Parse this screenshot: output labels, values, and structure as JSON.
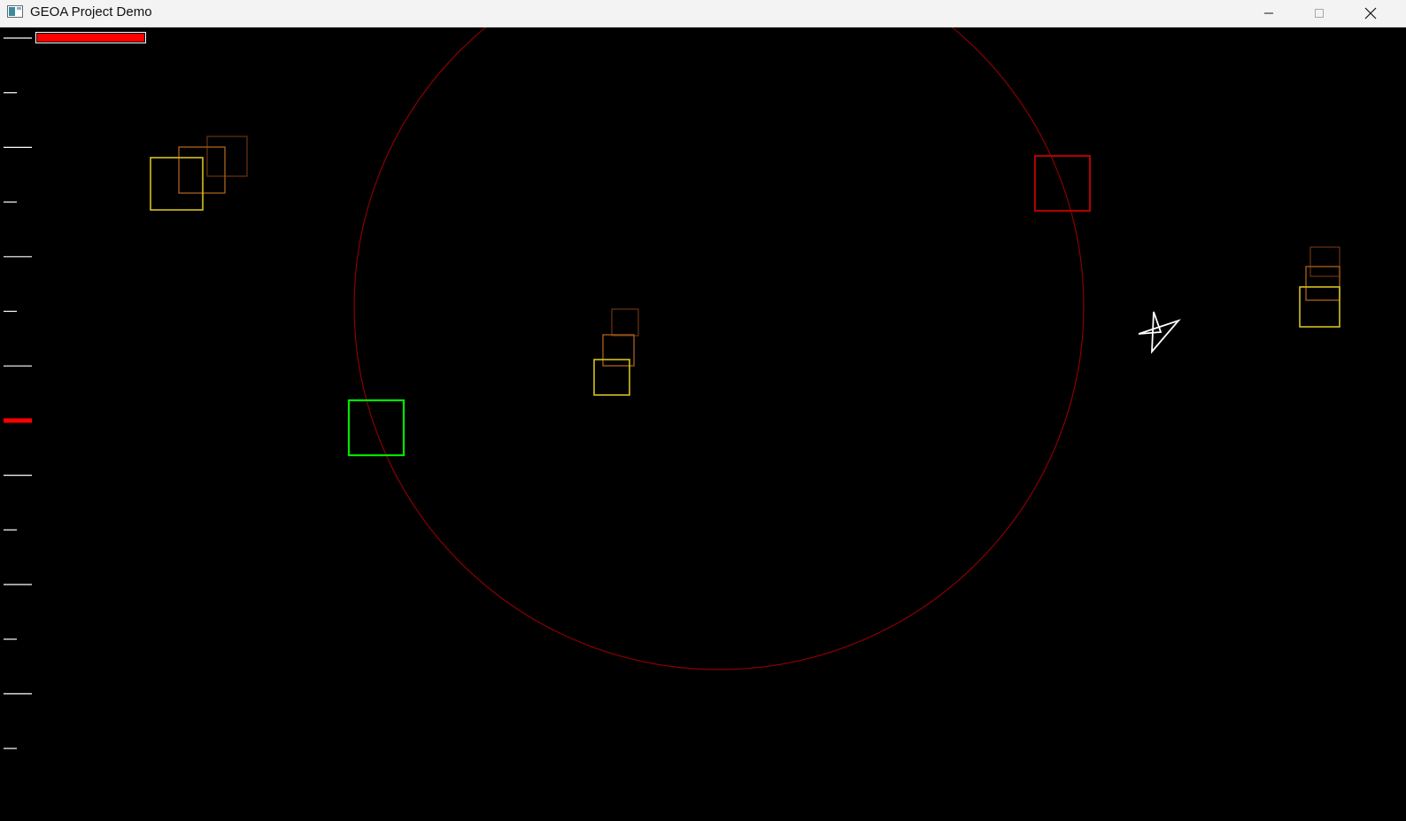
{
  "window": {
    "title": "GEOA Project Demo",
    "app_icon": "app-window-icon",
    "controls": {
      "minimize_icon": "minimize-icon",
      "maximize_icon": "maximize-icon",
      "close_icon": "close-icon"
    }
  },
  "scene": {
    "background_color": "#000000",
    "health_bar": {
      "fill_color": "#ff0000",
      "fill_fraction": 1.0
    },
    "depth_ruler": {
      "tick_count": 14,
      "active_index": 7,
      "tick_color": "#ffffff",
      "active_color": "#ff0000"
    },
    "boundary_circle": {
      "color": "#8b0000"
    },
    "player": {
      "shape": "pentagram-star",
      "color": "#ffffff"
    },
    "squares": [
      {
        "name": "yellow-square-trail",
        "color": "#d4c21c"
      },
      {
        "name": "orange-square-trail",
        "color": "#a05a1a"
      },
      {
        "name": "red-square",
        "color": "#b30000"
      },
      {
        "name": "green-square",
        "color": "#00e600"
      }
    ]
  }
}
